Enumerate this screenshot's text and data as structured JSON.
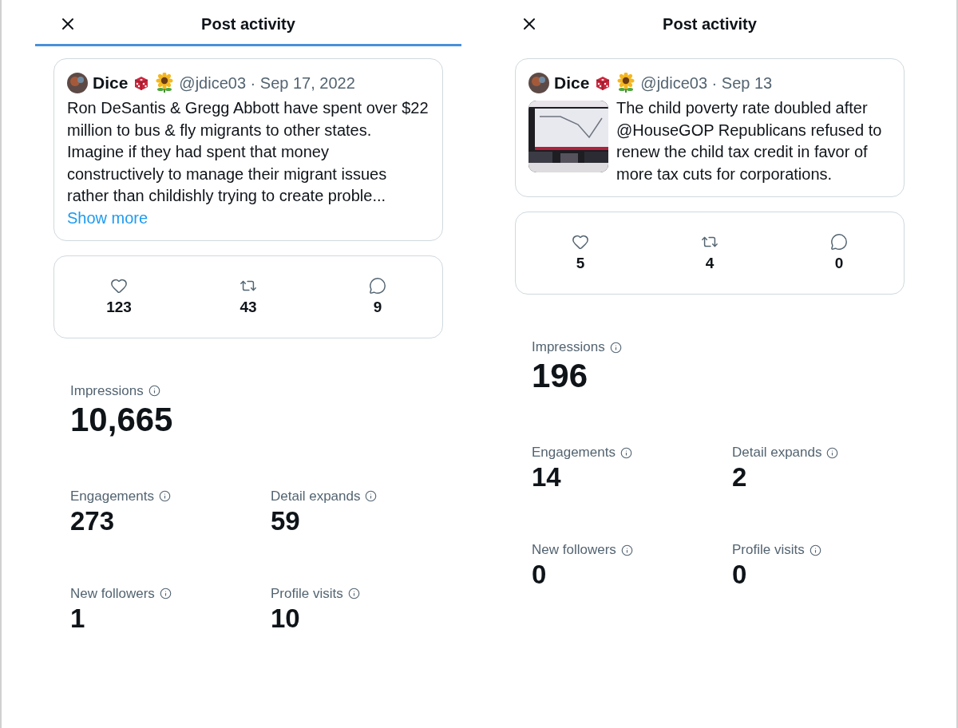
{
  "panels": [
    {
      "title": "Post activity",
      "loading": true,
      "post": {
        "author": "Dice",
        "meta": "@jdice03 · Sep 17, 2022",
        "text": "Ron DeSantis & Gregg Abbott have spent over $22 million to bus & fly migrants to other states. Imagine if they had spent that money constructively to manage their migrant issues rather than childishly trying to create proble...",
        "show_more": "Show more"
      },
      "metrics": [
        {
          "kind": "like",
          "count": "123"
        },
        {
          "kind": "repost",
          "count": "43"
        },
        {
          "kind": "reply",
          "count": "9"
        }
      ],
      "impressions": {
        "label": "Impressions",
        "value": "10,665"
      },
      "stats": [
        {
          "label": "Engagements",
          "value": "273"
        },
        {
          "label": "Detail expands",
          "value": "59"
        },
        {
          "label": "New followers",
          "value": "1"
        },
        {
          "label": "Profile visits",
          "value": "10"
        }
      ]
    },
    {
      "title": "Post activity",
      "loading": false,
      "post": {
        "author": "Dice",
        "meta": "@jdice03 · Sep 13",
        "text": "The child poverty rate doubled after @HouseGOP Republicans refused to renew the child tax credit in favor of more tax cuts for corporations."
      },
      "metrics": [
        {
          "kind": "like",
          "count": "5"
        },
        {
          "kind": "repost",
          "count": "4"
        },
        {
          "kind": "reply",
          "count": "0"
        }
      ],
      "impressions": {
        "label": "Impressions",
        "value": "196"
      },
      "stats": [
        {
          "label": "Engagements",
          "value": "14"
        },
        {
          "label": "Detail expands",
          "value": "2"
        },
        {
          "label": "New followers",
          "value": "0"
        },
        {
          "label": "Profile visits",
          "value": "0"
        }
      ]
    }
  ]
}
